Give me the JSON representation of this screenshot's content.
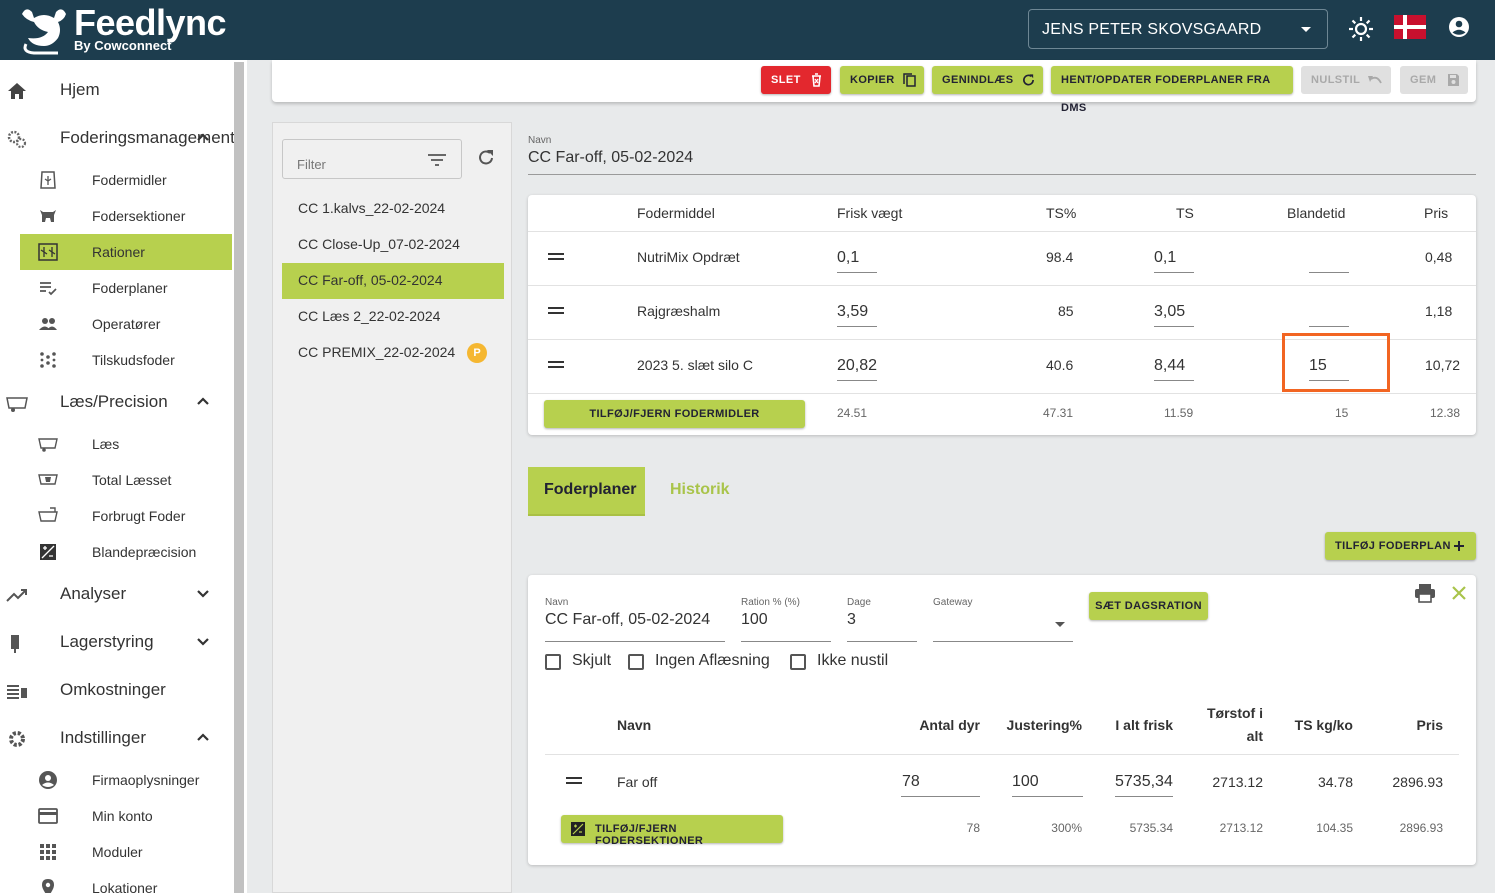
{
  "header": {
    "brand": "Feedlync",
    "brand_sub": "By Cowconnect",
    "user": "JENS PETER SKOVSGAARD"
  },
  "sidebar": {
    "home": "Hjem",
    "fodering": "Foderingsmanagement",
    "fodermidler": "Fodermidler",
    "fodersektioner": "Fodersektioner",
    "rationer": "Rationer",
    "foderplaner": "Foderplaner",
    "operatorer": "Operatører",
    "tilskudsfoder": "Tilskudsfoder",
    "laes_precision": "Læs/Precision",
    "laes": "Læs",
    "total_laesset": "Total Læsset",
    "forbrugt_foder": "Forbrugt Foder",
    "blandepraecision": "Blandepræcision",
    "analyser": "Analyser",
    "lagerstyring": "Lagerstyring",
    "omkostninger": "Omkostninger",
    "indstillinger": "Indstillinger",
    "firmaoplysninger": "Firmaoplysninger",
    "min_konto": "Min konto",
    "moduler": "Moduler",
    "lokationer": "Lokationer"
  },
  "toolbar": {
    "slet": "SLET",
    "kopier": "KOPIER",
    "genindlaes": "GENINDLÆS",
    "hent": "HENT/OPDATER FODERPLANER FRA DMS",
    "nulstil": "NULSTIL",
    "gem": "GEM"
  },
  "ration_list": {
    "filter_placeholder": "Filter",
    "items": [
      {
        "label": "CC 1.kalvs_22-02-2024"
      },
      {
        "label": "CC Close-Up_07-02-2024"
      },
      {
        "label": "CC Far-off, 05-02-2024"
      },
      {
        "label": "CC Læs 2_22-02-2024"
      },
      {
        "label": "CC PREMIX_22-02-2024",
        "badge": "P"
      }
    ]
  },
  "ration": {
    "name_label": "Navn",
    "name": "CC Far-off, 05-02-2024",
    "columns": {
      "fodermiddel": "Fodermiddel",
      "frisk": "Frisk vægt",
      "tspct": "TS%",
      "ts": "TS",
      "blandetid": "Blandetid",
      "pris": "Pris"
    },
    "rows": [
      {
        "name": "NutriMix Opdræt",
        "frisk": "0,1",
        "tspct": "98.4",
        "ts": "0,1",
        "blandetid": "",
        "pris": "0,48"
      },
      {
        "name": "Rajgræshalm",
        "frisk": "3,59",
        "tspct": "85",
        "ts": "3,05",
        "blandetid": "",
        "pris": "1,18"
      },
      {
        "name": "2023 5. slæt silo C",
        "frisk": "20,82",
        "tspct": "40.6",
        "ts": "8,44",
        "blandetid": "15",
        "pris": "10,72"
      }
    ],
    "add_button": "TILFØJ/FJERN FODERMIDLER",
    "totals": {
      "frisk": "24.51",
      "tspct": "47.31",
      "ts": "11.59",
      "blandetid": "15",
      "pris": "12.38"
    }
  },
  "tabs": {
    "foderplaner": "Foderplaner",
    "historik": "Historik"
  },
  "add_foderplan": "TILFØJ FODERPLAN",
  "foderplan": {
    "name_label": "Navn",
    "name": "CC Far-off, 05-02-2024",
    "ration_label": "Ration % (%)",
    "ration": "100",
    "dage_label": "Dage",
    "dage": "3",
    "gateway_label": "Gateway",
    "gateway": "",
    "set_button": "SÆT DAGSRATION",
    "checks": {
      "skjult": "Skjult",
      "ingen": "Ingen Aflæsning",
      "ikke": "Ikke nustil"
    },
    "columns": {
      "navn": "Navn",
      "antal": "Antal dyr",
      "justering": "Justering%",
      "ialt": "I alt frisk",
      "torstof1": "Tørstof i",
      "torstof2": "alt",
      "tskg": "TS kg/ko",
      "pris": "Pris"
    },
    "row": {
      "navn": "Far off",
      "antal": "78",
      "justering": "100",
      "ialt": "5735,34",
      "torstof": "2713.12",
      "tskg": "34.78",
      "pris": "2896.93"
    },
    "totals": {
      "antal": "78",
      "justering": "300%",
      "ialt": "5735.34",
      "torstof": "2713.12",
      "tskg": "104.35",
      "pris": "2896.93"
    },
    "section_button": "TILFØJ/FJERN FODERSEKTIONER"
  }
}
